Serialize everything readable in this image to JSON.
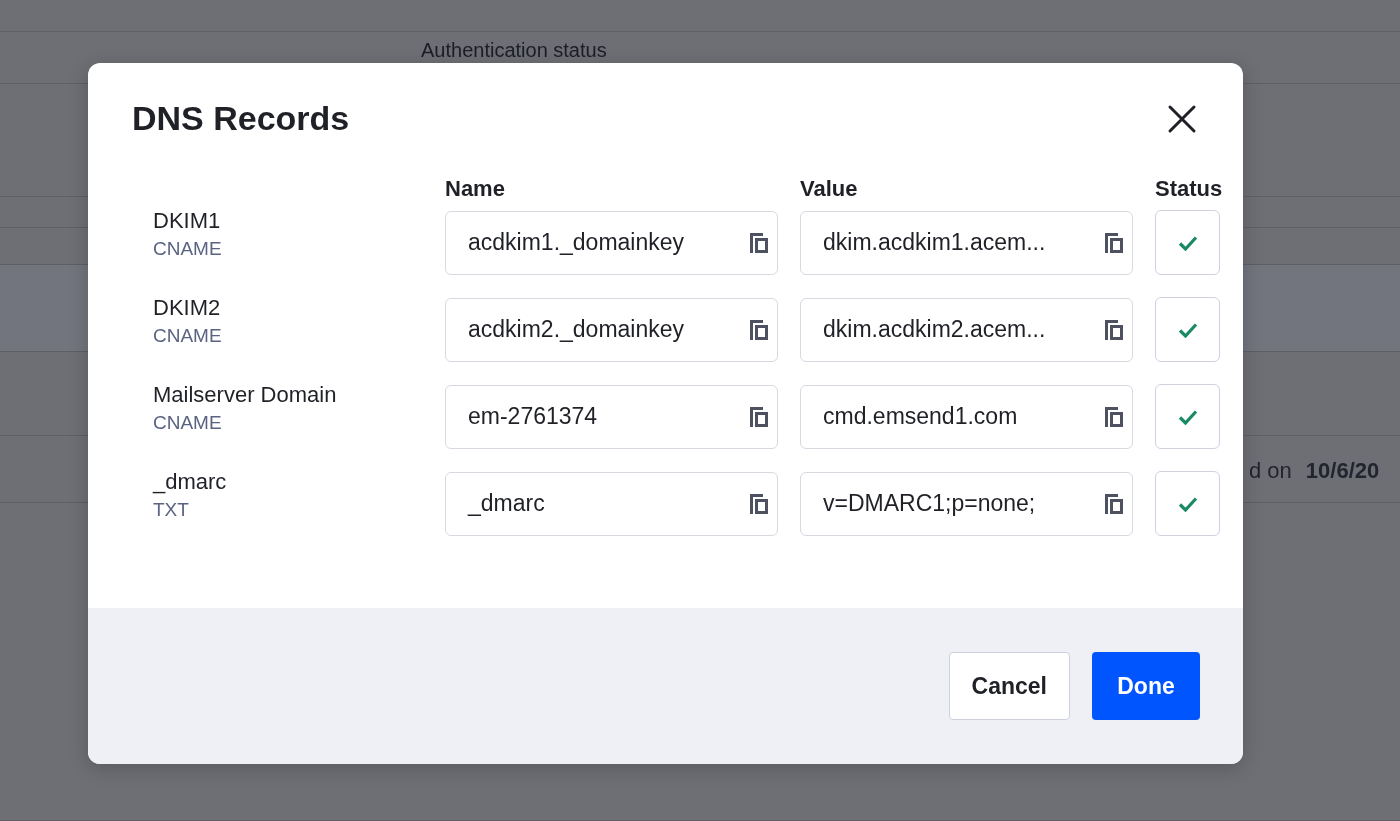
{
  "background": {
    "heading": "Authentication status",
    "note_prefix": "d on",
    "note_date": "10/6/20"
  },
  "dialog": {
    "title": "DNS Records",
    "columns": [
      "Name",
      "Value",
      "Status"
    ],
    "records": [
      {
        "label": "DKIM1",
        "type": "CNAME",
        "name": "acdkim1._domainkey",
        "value": "dkim.acdkim1.acem...",
        "verified": true
      },
      {
        "label": "DKIM2",
        "type": "CNAME",
        "name": "acdkim2._domainkey",
        "value": "dkim.acdkim2.acem...",
        "verified": true
      },
      {
        "label": "Mailserver Domain",
        "type": "CNAME",
        "name": "em-2761374",
        "value": "cmd.emsend1.com",
        "verified": true
      },
      {
        "label": "_dmarc",
        "type": "TXT",
        "name": "_dmarc",
        "value": "v=DMARC1;p=none;",
        "verified": true
      }
    ],
    "buttons": [
      {
        "label": "Cancel",
        "kind": "secondary"
      },
      {
        "label": "Done",
        "kind": "primary"
      }
    ]
  }
}
